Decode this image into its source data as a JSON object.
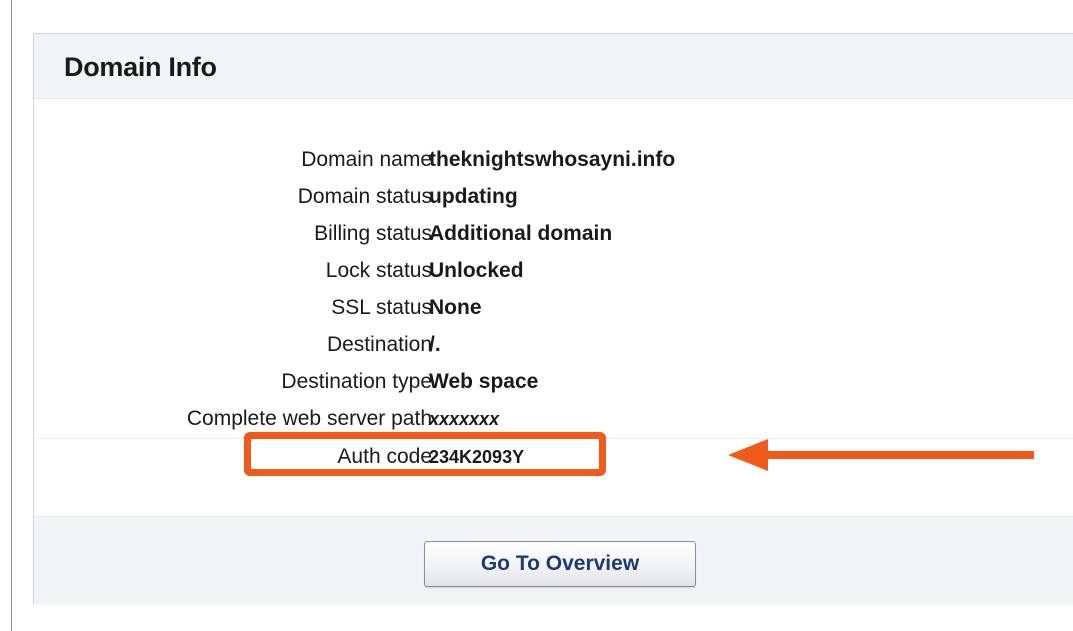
{
  "panel": {
    "title": "Domain Info"
  },
  "info": {
    "rows": [
      {
        "label": "Domain name",
        "value": "theknightswhosayni.info"
      },
      {
        "label": "Domain status",
        "value": "updating"
      },
      {
        "label": "Billing status",
        "value": "Additional domain"
      },
      {
        "label": "Lock status",
        "value": "Unlocked"
      },
      {
        "label": "SSL status",
        "value": "None"
      },
      {
        "label": "Destination",
        "value": "/."
      },
      {
        "label": "Destination type",
        "value": "Web space"
      },
      {
        "label": "Complete web server path",
        "value": "xxxxxxx"
      },
      {
        "label": "Auth code",
        "value": "234K2093Y"
      }
    ]
  },
  "footer": {
    "button_label": "Go To Overview"
  },
  "colors": {
    "highlight": "#f05a1a",
    "button_text": "#1d3b73",
    "panel_bg": "#f2f4f7"
  }
}
